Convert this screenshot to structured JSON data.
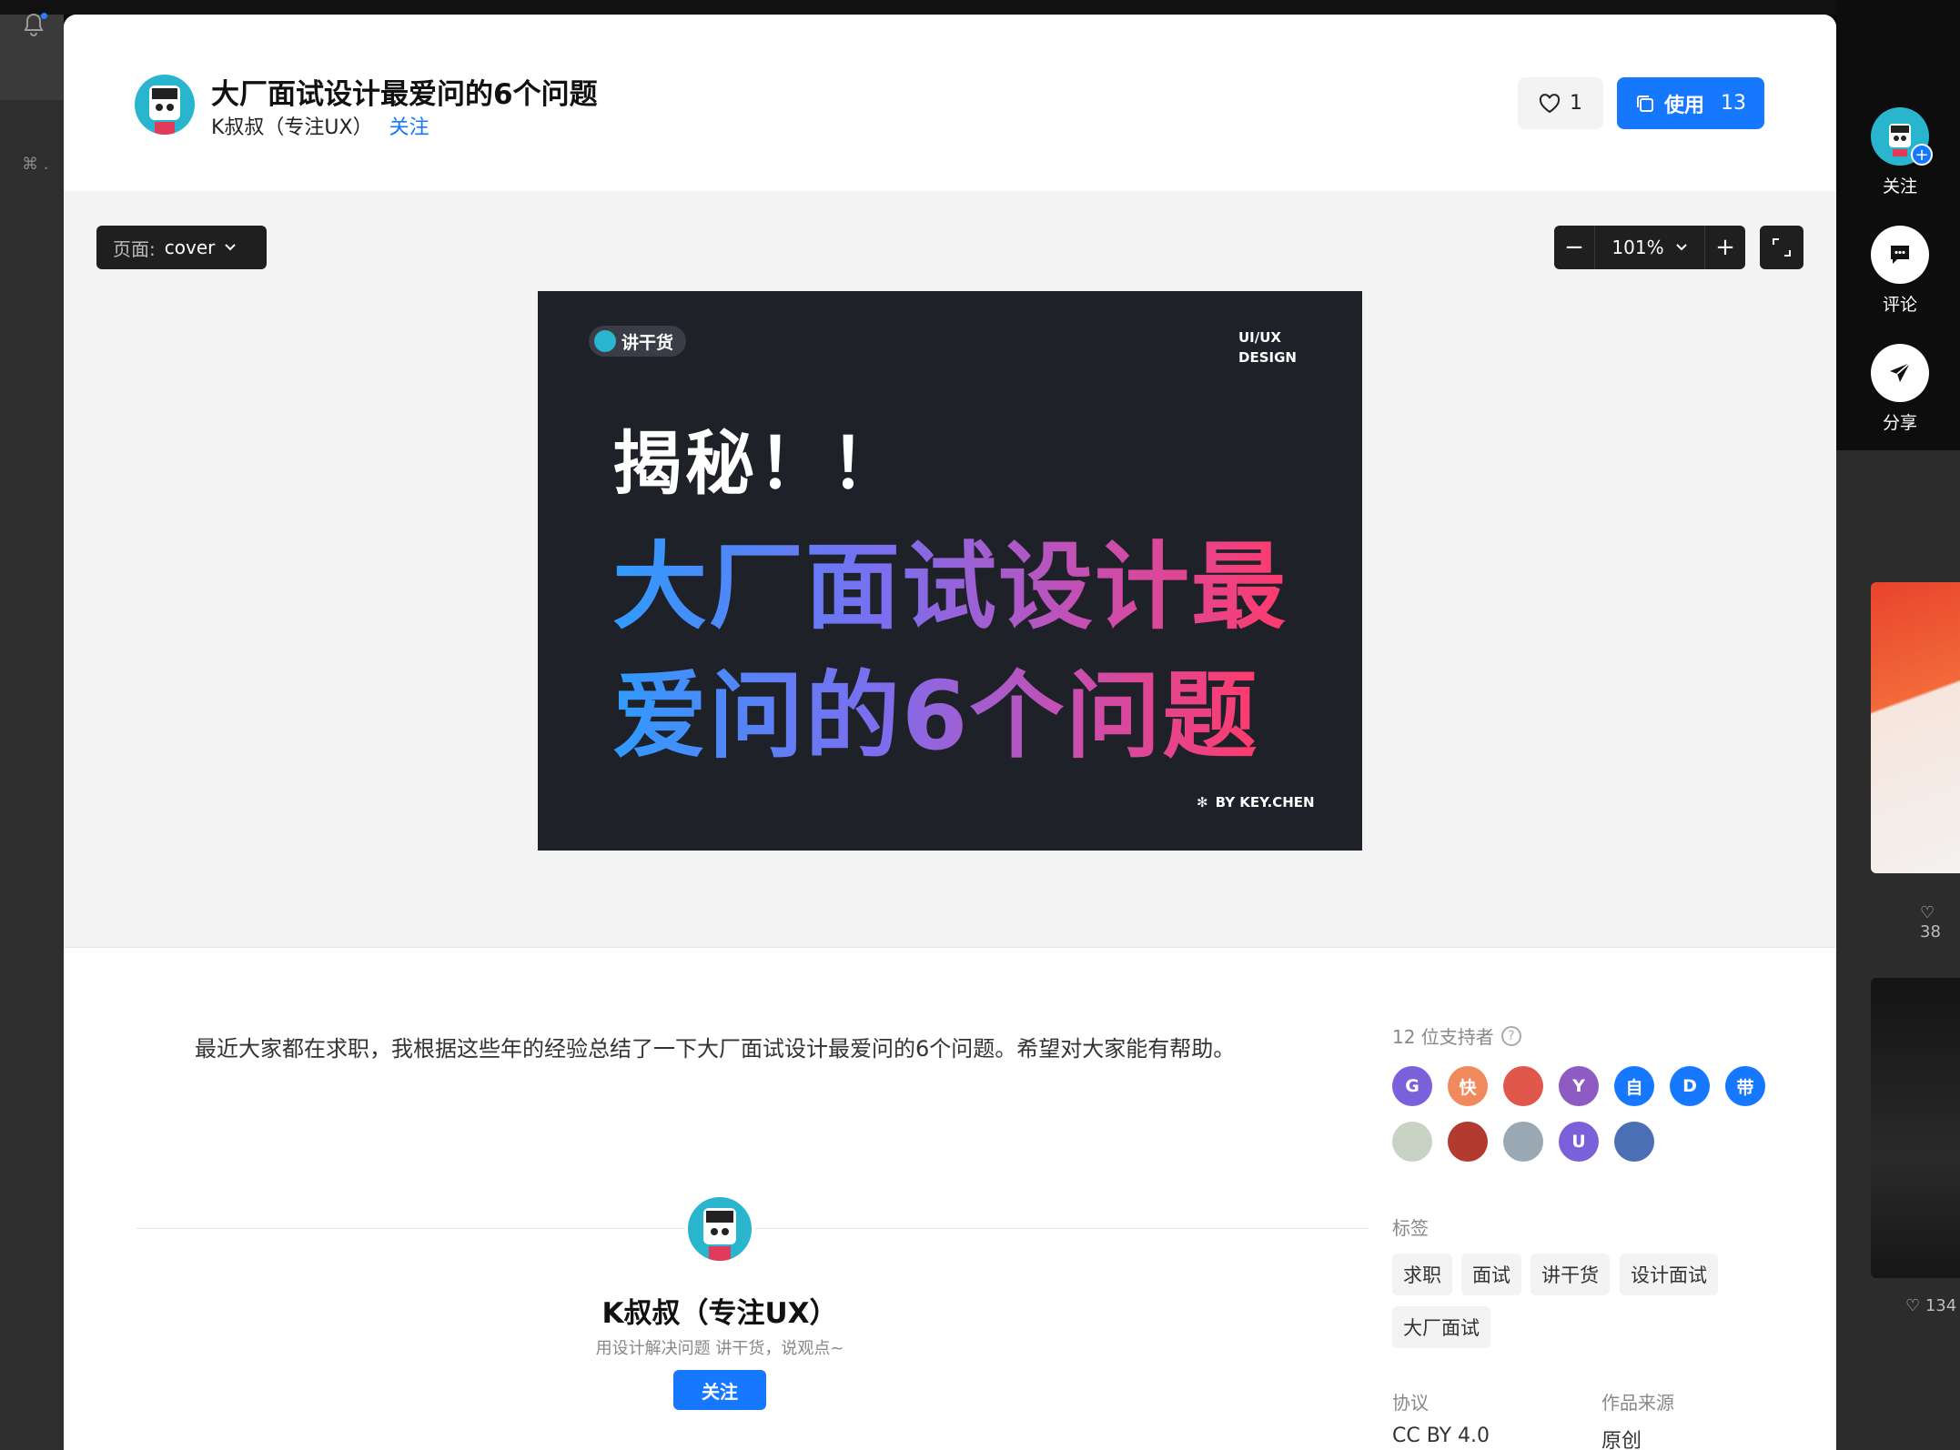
{
  "modal": {
    "title": "大厂面试设计最爱问的6个问题",
    "author": "K叔叔（专注UX）",
    "follow_link": "关注",
    "like_count": "1",
    "use_label": "使用",
    "use_count": "13"
  },
  "canvas": {
    "page_prefix": "页面:",
    "page_value": "cover",
    "zoom_value": "101%",
    "zoom_out": "−",
    "zoom_in": "+"
  },
  "cover": {
    "badge": "讲干货",
    "design_line1": "UI/UX",
    "design_line2": "DESIGN",
    "reveal": "揭秘！！",
    "line1": "大厂面试设计最",
    "line2": "爱问的6个问题",
    "by": "BY KEY.CHEN"
  },
  "description": "最近大家都在求职，我根据这些年的经验总结了一下大厂面试设计最爱问的6个问题。希望对大家能有帮助。",
  "author_card": {
    "name": "K叔叔（专注UX）",
    "bio": "用设计解决问题 讲干货，说观点~",
    "follow": "关注"
  },
  "sidebar": {
    "supporters_heading": "12 位支持者",
    "supporters": [
      {
        "initial": "G",
        "color": "#7b61d9"
      },
      {
        "initial": "快",
        "color": "#f08a5d"
      },
      {
        "initial": "",
        "color": "#e2574c"
      },
      {
        "initial": "Y",
        "color": "#8e5bc2"
      },
      {
        "initial": "自",
        "color": "#1677ff"
      },
      {
        "initial": "D",
        "color": "#1677ff"
      },
      {
        "initial": "带",
        "color": "#1677ff"
      },
      {
        "initial": "",
        "color": "#c9d3c4"
      },
      {
        "initial": "",
        "color": "#b23a2e"
      },
      {
        "initial": "",
        "color": "#9aa8b4"
      },
      {
        "initial": "U",
        "color": "#7b61d9"
      },
      {
        "initial": "",
        "color": "#4a6fb5"
      }
    ],
    "tags_heading": "标签",
    "tags": [
      "求职",
      "面试",
      "讲干货",
      "设计面试",
      "大厂面试"
    ],
    "license_heading": "协议",
    "license_value": "CC BY 4.0",
    "source_heading": "作品来源",
    "source_value": "原创"
  },
  "floating_actions": {
    "follow": "关注",
    "comment": "评论",
    "share": "分享"
  },
  "background": {
    "cmd_hint": "⌘ .",
    "count1": "38",
    "count2": "134"
  }
}
